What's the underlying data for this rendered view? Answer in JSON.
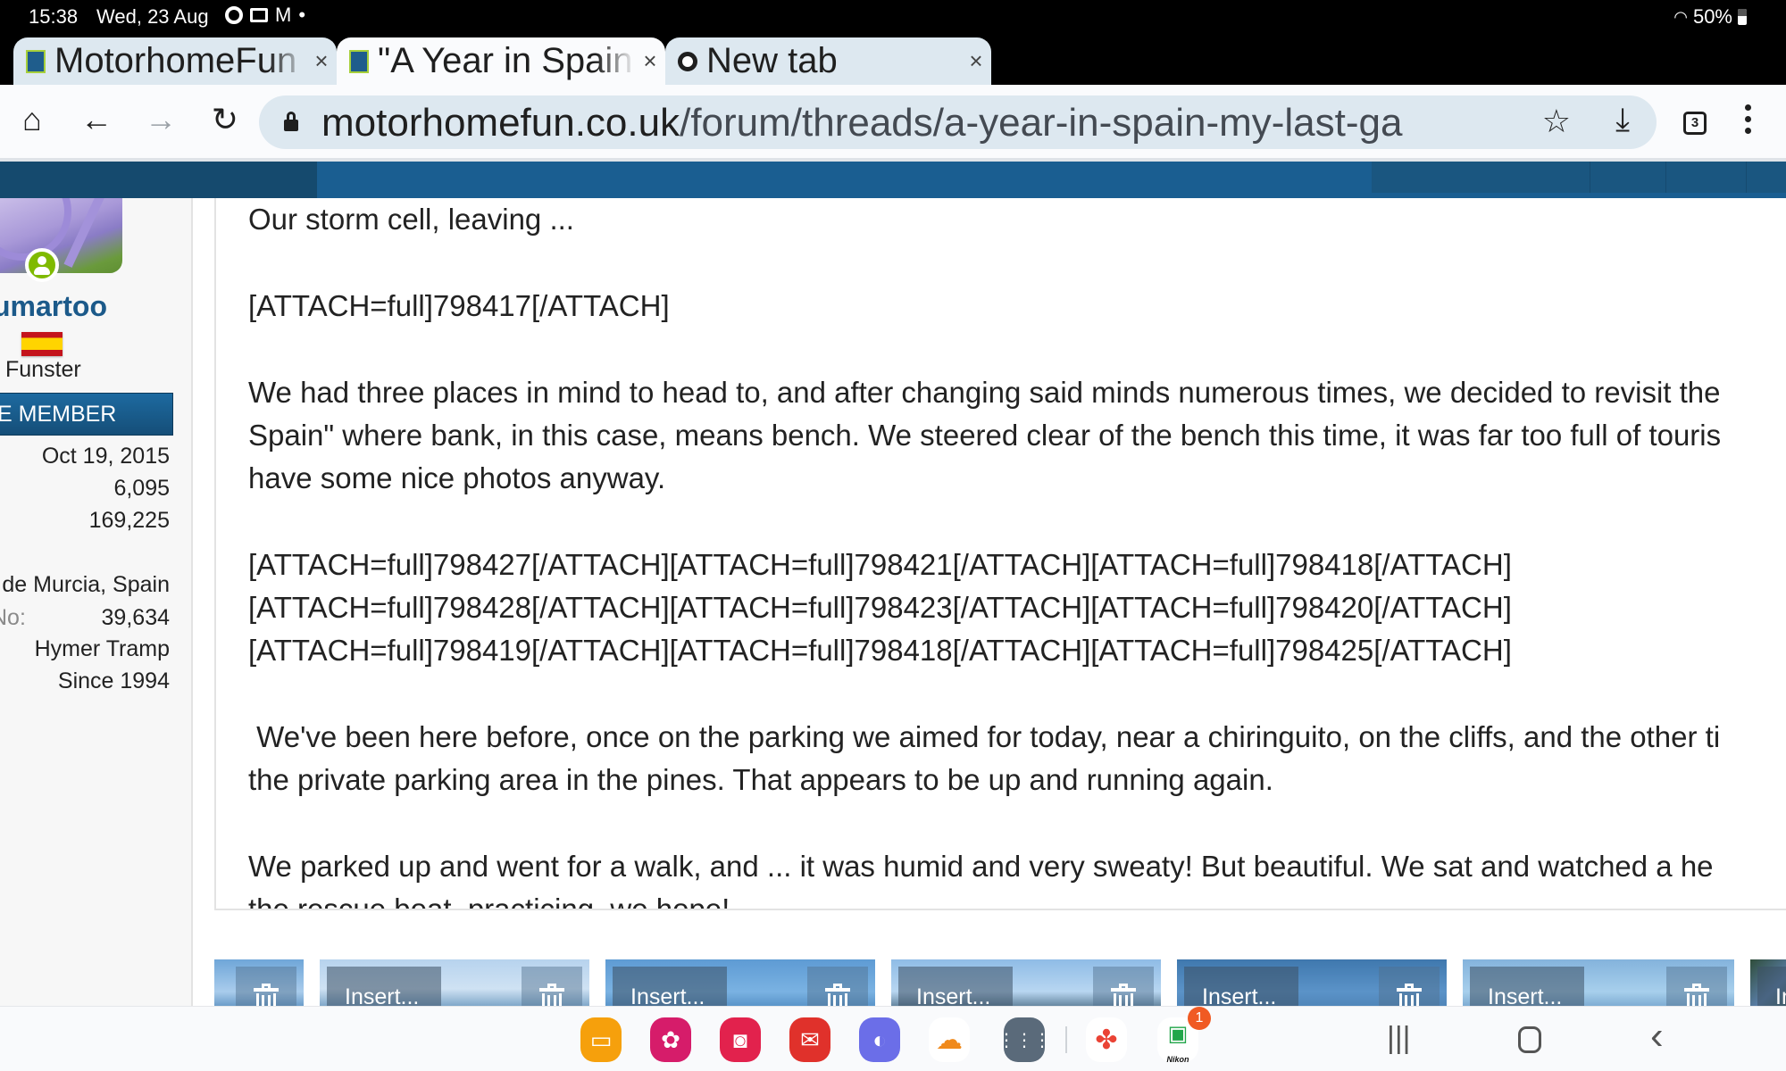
{
  "status_bar": {
    "time": "15:38",
    "date": "Wed, 23 Aug",
    "notification_icons": [
      "chrome-icon",
      "transfer-icon",
      "gmail-icon",
      "dot-icon"
    ],
    "battery": "50%",
    "wifi_icon": "wifi-icon"
  },
  "tabs": [
    {
      "title": "MotorhomeFun",
      "favicon": "motorhomefun-favicon",
      "active": false,
      "close": "×"
    },
    {
      "title": "\"A Year in Spain",
      "favicon": "motorhomefun-favicon",
      "active": true,
      "close": "×"
    },
    {
      "title": "New tab",
      "favicon": "chrome-icon",
      "active": false,
      "close": "×"
    }
  ],
  "new_tab_label": "+",
  "toolbar": {
    "home": "⌂",
    "back": "←",
    "forward": "→",
    "reload": "↻",
    "url_domain": "motorhomefun.co.uk",
    "url_path": "/forum/threads/a-year-in-spain-my-last-ga",
    "bookmark": "☆",
    "download": "⤓",
    "tab_count": "3"
  },
  "sidebar": {
    "username": "umartoo",
    "user_title": "Funster",
    "member_banner": "E MEMBER",
    "joined": "Oct 19, 2015",
    "messages": "6,095",
    "reaction_score": "169,225",
    "location": "de Murcia, Spain",
    "member_no_label": "No:",
    "member_no": "39,634",
    "vehicle": "Hymer Tramp",
    "since": "Since 1994"
  },
  "editor": {
    "paragraphs": [
      "Our storm cell, leaving ...",
      "[ATTACH=full]798417[/ATTACH]",
      "We had three places in mind to head to, and after changing said minds numerous times, we decided to revisit the",
      "Spain\" where bank, in this case, means bench.  We steered clear of the bench this time, it was far too full of touris",
      "have some nice photos anyway.",
      "[ATTACH=full]798427[/ATTACH][ATTACH=full]798421[/ATTACH][ATTACH=full]798418[/ATTACH]",
      "[ATTACH=full]798428[/ATTACH][ATTACH=full]798423[/ATTACH][ATTACH=full]798420[/ATTACH]",
      "[ATTACH=full]798419[/ATTACH][ATTACH=full]798418[/ATTACH][ATTACH=full]798425[/ATTACH]",
      " We've been here before, once on the parking we aimed for today, near a chiringuito, on the cliffs, and the other ti",
      "the private parking area in the pines.  That appears to be up and running again.",
      "We parked up and went for a walk, and ... it was humid and very sweaty!  But beautiful.  We sat and watched a he",
      "the rescue boat, practicing, we hope!"
    ]
  },
  "attachments": {
    "insert_label": "Insert...",
    "delete_icon": "trash-icon",
    "count_visible": 7
  },
  "dock": {
    "apps": [
      "my-files",
      "gallery",
      "camera",
      "email",
      "internet",
      "cloud",
      "app-drawer",
      "google-photos",
      "nikon"
    ],
    "nikon_label": "Nikon",
    "nikon_badge": "1"
  },
  "nav": {
    "recents": "|||",
    "home": "○",
    "back": "‹"
  }
}
